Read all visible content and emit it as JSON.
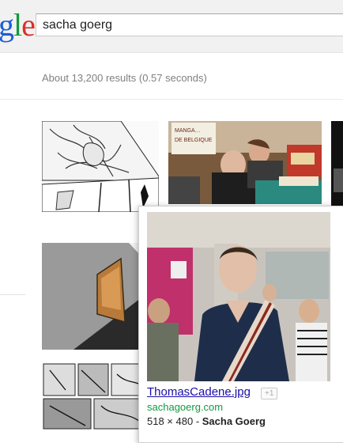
{
  "logo": {
    "visible_text_1": "g",
    "visible_text_2": "l",
    "visible_text_3": "e"
  },
  "search": {
    "query": "sacha goerg"
  },
  "results": {
    "stats": "About 13,200 results (0.57 seconds)"
  },
  "hover_card": {
    "filename": "ThomasCadene.jpg",
    "plus_one": "+1",
    "site": "sachagoerg.com",
    "dimensions": "518 × 480",
    "separator": " - ",
    "author": "Sacha Goerg"
  },
  "colors": {
    "link": "#1a0dab",
    "url_green": "#109a3f",
    "logo_blue": "#1a5fd6",
    "logo_red": "#d8322a"
  }
}
